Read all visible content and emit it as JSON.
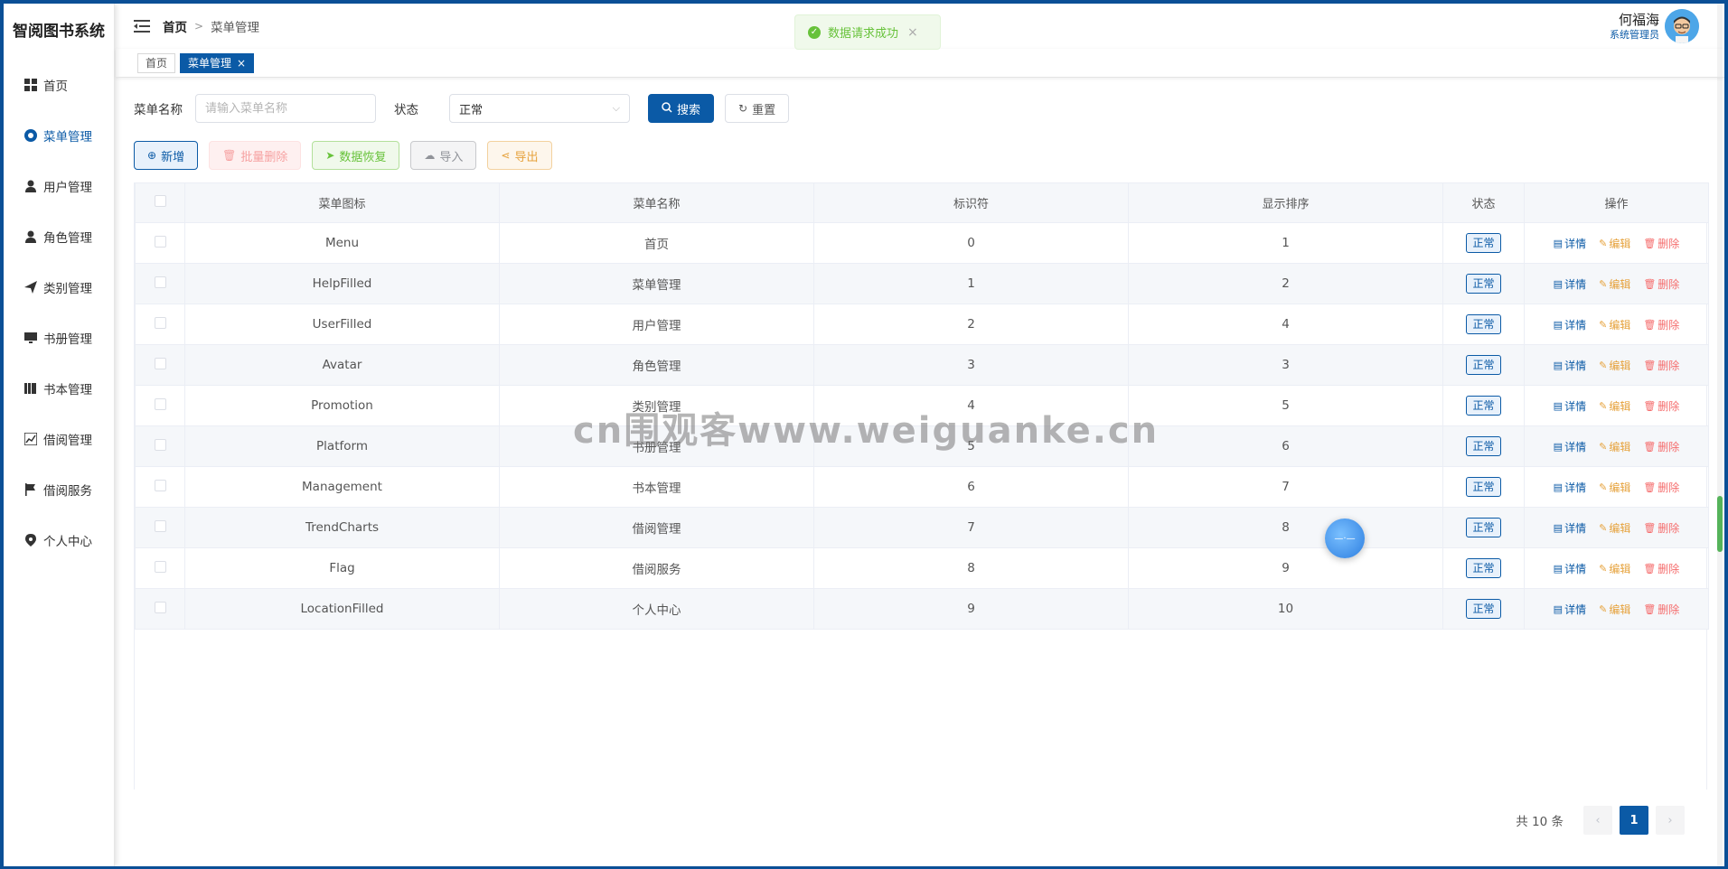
{
  "app": {
    "title": "智阅图书系统"
  },
  "sidebar": {
    "items": [
      {
        "label": "首页",
        "icon": "grid-icon"
      },
      {
        "label": "菜单管理",
        "icon": "help-icon",
        "active": true
      },
      {
        "label": "用户管理",
        "icon": "user-icon"
      },
      {
        "label": "角色管理",
        "icon": "avatar-icon"
      },
      {
        "label": "类别管理",
        "icon": "send-icon"
      },
      {
        "label": "书册管理",
        "icon": "monitor-icon"
      },
      {
        "label": "书本管理",
        "icon": "books-icon"
      },
      {
        "label": "借阅管理",
        "icon": "trend-icon"
      },
      {
        "label": "借阅服务",
        "icon": "flag-icon"
      },
      {
        "label": "个人中心",
        "icon": "location-icon"
      }
    ]
  },
  "header": {
    "breadcrumb_home": "首页",
    "breadcrumb_current": "菜单管理",
    "user_name": "何福海",
    "user_role": "系统管理员"
  },
  "tags": [
    {
      "label": "首页"
    },
    {
      "label": "菜单管理",
      "close": "×"
    }
  ],
  "toast": {
    "text": "数据请求成功",
    "close": "×"
  },
  "search": {
    "name_label": "菜单名称",
    "name_placeholder": "请输入菜单名称",
    "status_label": "状态",
    "status_value": "正常",
    "search_button": "搜索",
    "reset_button": "重置"
  },
  "actions": {
    "add": "新增",
    "batch_delete": "批量删除",
    "restore": "数据恢复",
    "import": "导入",
    "export": "导出"
  },
  "table": {
    "columns": [
      "菜单图标",
      "菜单名称",
      "标识符",
      "显示排序",
      "状态",
      "操作"
    ],
    "rows": [
      {
        "icon": "Menu",
        "name": "首页",
        "id": "0",
        "order": "1",
        "status": "正常"
      },
      {
        "icon": "HelpFilled",
        "name": "菜单管理",
        "id": "1",
        "order": "2",
        "status": "正常"
      },
      {
        "icon": "UserFilled",
        "name": "用户管理",
        "id": "2",
        "order": "4",
        "status": "正常"
      },
      {
        "icon": "Avatar",
        "name": "角色管理",
        "id": "3",
        "order": "3",
        "status": "正常"
      },
      {
        "icon": "Promotion",
        "name": "类别管理",
        "id": "4",
        "order": "5",
        "status": "正常"
      },
      {
        "icon": "Platform",
        "name": "书册管理",
        "id": "5",
        "order": "6",
        "status": "正常"
      },
      {
        "icon": "Management",
        "name": "书本管理",
        "id": "6",
        "order": "7",
        "status": "正常"
      },
      {
        "icon": "TrendCharts",
        "name": "借阅管理",
        "id": "7",
        "order": "8",
        "status": "正常"
      },
      {
        "icon": "Flag",
        "name": "借阅服务",
        "id": "8",
        "order": "9",
        "status": "正常"
      },
      {
        "icon": "LocationFilled",
        "name": "个人中心",
        "id": "9",
        "order": "10",
        "status": "正常"
      }
    ],
    "ops": {
      "detail": "详情",
      "edit": "编辑",
      "delete": "删除"
    }
  },
  "pagination": {
    "total": "共 10 条",
    "current": "1",
    "prev": "‹",
    "next": "›"
  },
  "watermark": "cn围观客www.weiguanke.cn",
  "colors": {
    "primary": "#0b5aa6",
    "success": "#67c23a",
    "danger": "#f56c6c",
    "warning": "#e6a23c"
  }
}
